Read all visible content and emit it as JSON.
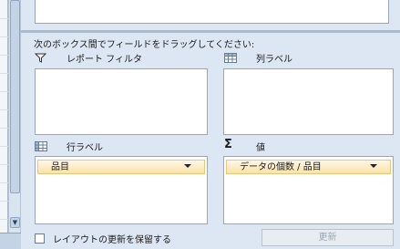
{
  "panel": {
    "instruction": "次のボックス間でフィールドをドラッグしてください:",
    "areas": {
      "report_filter": {
        "label": "レポート フィルタ",
        "icon": "filter-icon"
      },
      "column_labels": {
        "label": "列ラベル",
        "icon": "column-grid-icon"
      },
      "row_labels": {
        "label": "行ラベル",
        "icon": "row-grid-icon",
        "fields": [
          "品目"
        ]
      },
      "values": {
        "label": "値",
        "icon": "sigma-icon",
        "fields": [
          "データの個数 / 品目"
        ]
      }
    },
    "defer_update_label": "レイアウトの更新を保留する",
    "update_button": "更新"
  }
}
